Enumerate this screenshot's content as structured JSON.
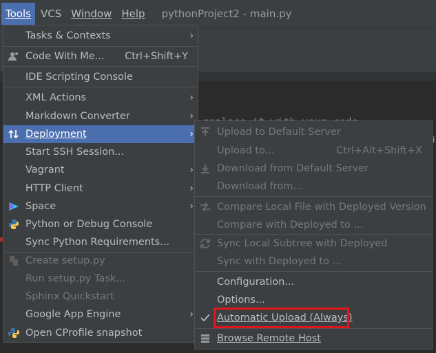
{
  "menubar": {
    "items": [
      {
        "label": "Tools",
        "active": true
      },
      {
        "label": "VCS",
        "active": false
      },
      {
        "label": "Window",
        "active": false
      },
      {
        "label": "Help",
        "active": false
      }
    ],
    "title": "pythonProject2 - main.py"
  },
  "editor": {
    "hint_text": "replace it with your code",
    "edge_char": "i"
  },
  "tools_menu": {
    "items": [
      {
        "label": "Tasks & Contexts",
        "submenu": true
      },
      {
        "label": "Code With Me...",
        "shortcut": "Ctrl+Shift+Y",
        "icon": "code-with-me-icon"
      },
      {
        "label": "IDE Scripting Console"
      },
      {
        "label": "XML Actions",
        "submenu": true
      },
      {
        "label": "Markdown Converter",
        "submenu": true
      },
      {
        "label": "Deployment",
        "submenu": true,
        "highlighted": true,
        "icon": "deployment-icon"
      },
      {
        "label": "Start SSH Session..."
      },
      {
        "label": "Vagrant",
        "submenu": true
      },
      {
        "label": "HTTP Client",
        "submenu": true
      },
      {
        "label": "Space",
        "submenu": true,
        "icon": "space-icon"
      },
      {
        "label": "Python or Debug Console",
        "icon": "python-icon"
      },
      {
        "label": "Sync Python Requirements..."
      },
      {
        "label": "Create setup.py",
        "disabled": true,
        "icon": "setup-icon"
      },
      {
        "label": "Run setup.py Task...",
        "disabled": true
      },
      {
        "label": "Sphinx Quickstart",
        "disabled": true
      },
      {
        "label": "Google App Engine",
        "submenu": true
      },
      {
        "label": "Open CProfile snapshot",
        "icon": "cprofile-icon"
      }
    ]
  },
  "deployment_menu": {
    "items": [
      {
        "label": "Upload to Default Server",
        "disabled": true,
        "icon": "upload-icon"
      },
      {
        "label": "Upload to...",
        "shortcut": "Ctrl+Alt+Shift+X",
        "disabled": true
      },
      {
        "label": "Download from Default Server",
        "disabled": true,
        "icon": "download-icon"
      },
      {
        "label": "Download from...",
        "disabled": true
      },
      {
        "label": "Compare Local File with Deployed Version",
        "disabled": true,
        "icon": "compare-icon"
      },
      {
        "label": "Compare with Deployed to ...",
        "disabled": true
      },
      {
        "label": "Sync Local Subtree with Deployed",
        "disabled": true,
        "icon": "sync-icon"
      },
      {
        "label": "Sync with Deployed to ...",
        "disabled": true
      },
      {
        "label": "Configuration..."
      },
      {
        "label": "Options..."
      },
      {
        "label": "Automatic Upload (Always)",
        "checked": true
      },
      {
        "label": "Browse Remote Host",
        "icon": "browse-remote-icon"
      }
    ]
  },
  "colors": {
    "menu_bg": "#3c3f41",
    "highlight": "#4b6eaf",
    "callout": "#e0161a"
  }
}
